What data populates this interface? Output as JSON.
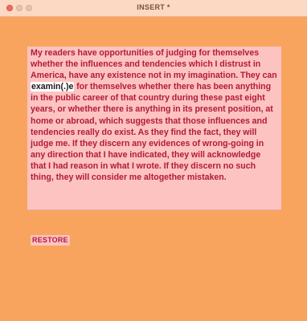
{
  "window": {
    "title": "INSERT *"
  },
  "editor": {
    "before": "My readers have opportunities of judging for themselves whether the influences and tendencies which I distrust in America, have any existence not in my imagination. They can ",
    "highlight": "examin(.)e",
    "after": " for themselves whether there has been anything in the public career of that country during these past eight years, or whether there is anything in its present position, at home or abroad, which suggests that those influences and tendencies really do exist. As they find the fact, they will judge me. If they discern any evidences of wrong-going in any direction that I have indicated, they will acknowledge that I had reason in what I wrote. If they discern no such thing, they will consider me altogether mistaken."
  },
  "actions": {
    "restore_label": "RESTORE"
  },
  "colors": {
    "background": "#f9a45e",
    "panel": "#fcc3c1",
    "text": "#b31a3a",
    "highlight": "#ffffff"
  }
}
